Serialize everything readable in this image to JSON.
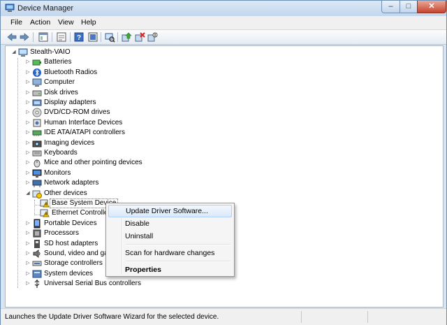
{
  "window": {
    "title": "Device Manager"
  },
  "caption_buttons": {
    "minimize": "–",
    "maximize": "□",
    "close": "✕"
  },
  "menu": [
    "File",
    "Action",
    "View",
    "Help"
  ],
  "toolbar": [
    "back-icon",
    "forward-icon",
    "properties-pane-icon",
    "show-hide-icon",
    "help-icon",
    "help-book-icon",
    "scan-hardware-icon",
    "update-driver-icon",
    "uninstall-icon",
    "disable-icon"
  ],
  "tree": {
    "root": "Stealth-VAIO",
    "categories": [
      {
        "label": "Batteries",
        "icon": "battery-icon"
      },
      {
        "label": "Bluetooth Radios",
        "icon": "bluetooth-icon"
      },
      {
        "label": "Computer",
        "icon": "computer-icon"
      },
      {
        "label": "Disk drives",
        "icon": "disk-drive-icon"
      },
      {
        "label": "Display adapters",
        "icon": "display-adapter-icon"
      },
      {
        "label": "DVD/CD-ROM drives",
        "icon": "dvd-drive-icon"
      },
      {
        "label": "Human Interface Devices",
        "icon": "hid-icon"
      },
      {
        "label": "IDE ATA/ATAPI controllers",
        "icon": "ide-controller-icon"
      },
      {
        "label": "Imaging devices",
        "icon": "camera-icon"
      },
      {
        "label": "Keyboards",
        "icon": "keyboard-icon"
      },
      {
        "label": "Mice and other pointing devices",
        "icon": "mouse-icon"
      },
      {
        "label": "Monitors",
        "icon": "monitor-icon"
      },
      {
        "label": "Network adapters",
        "icon": "network-adapter-icon"
      },
      {
        "label": "Other devices",
        "icon": "other-devices-icon",
        "expanded": true
      },
      {
        "label": "Portable Devices",
        "icon": "portable-device-icon"
      },
      {
        "label": "Processors",
        "icon": "processor-icon"
      },
      {
        "label": "SD host adapters",
        "icon": "sd-host-icon"
      },
      {
        "label": "Sound, video and game controllers",
        "icon": "sound-icon"
      },
      {
        "label": "Storage controllers",
        "icon": "storage-controller-icon"
      },
      {
        "label": "System devices",
        "icon": "system-device-icon"
      },
      {
        "label": "Universal Serial Bus controllers",
        "icon": "usb-icon"
      }
    ],
    "other_devices": [
      {
        "label": "Base System Device",
        "icon": "warning-device-icon"
      },
      {
        "label": "Ethernet Controller",
        "icon": "warning-device-icon"
      }
    ]
  },
  "context_menu": {
    "items": [
      {
        "label": "Update Driver Software...",
        "highlighted": true
      },
      {
        "label": "Disable"
      },
      {
        "label": "Uninstall"
      },
      {
        "label": "Scan for hardware changes"
      },
      {
        "label": "Properties",
        "bold": true
      }
    ]
  },
  "status": "Launches the Update Driver Software Wizard for the selected device.",
  "colors": {
    "accent": "#aecff7",
    "close": "#c7432c",
    "warning": "#f7c600"
  }
}
